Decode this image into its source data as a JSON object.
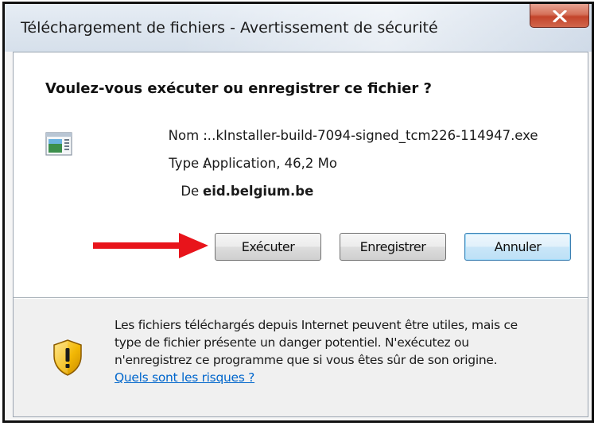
{
  "window": {
    "title": "Téléchargement de fichiers - Avertissement de sécurité",
    "close_icon": "close-icon"
  },
  "dialog": {
    "question": "Voulez-vous exécuter ou enregistrer ce fichier ?",
    "file_icon": "application-file-icon",
    "fields": [
      {
        "label": "Nom :",
        "value": "…kInstaller-build-7094-signed_tcm226-114947.exe",
        "bold": false
      },
      {
        "label": "Type :",
        "value": "Application, 46,2 Mo",
        "bold": false
      },
      {
        "label": "De :",
        "value": "eid.belgium.be",
        "bold": true
      }
    ],
    "annotation_arrow": {
      "icon": "red-arrow-icon",
      "color": "#e8141b"
    }
  },
  "buttons": {
    "run": "Exécuter",
    "save": "Enregistrer",
    "cancel": "Annuler"
  },
  "warning": {
    "icon": "shield-warning-icon",
    "lines": [
      "Les fichiers téléchargés depuis Internet peuvent être utiles, mais ce",
      "type de fichier présente un danger potentiel. N'exécutez ou",
      "n'enregistrez ce programme que si vous êtes sûr de son origine."
    ],
    "link": "Quels sont les risques ?"
  },
  "colors": {
    "link": "#0066cc",
    "close_button": "#c3442b",
    "default_button_border": "#3c7fb1",
    "shield": "#f2b705"
  }
}
